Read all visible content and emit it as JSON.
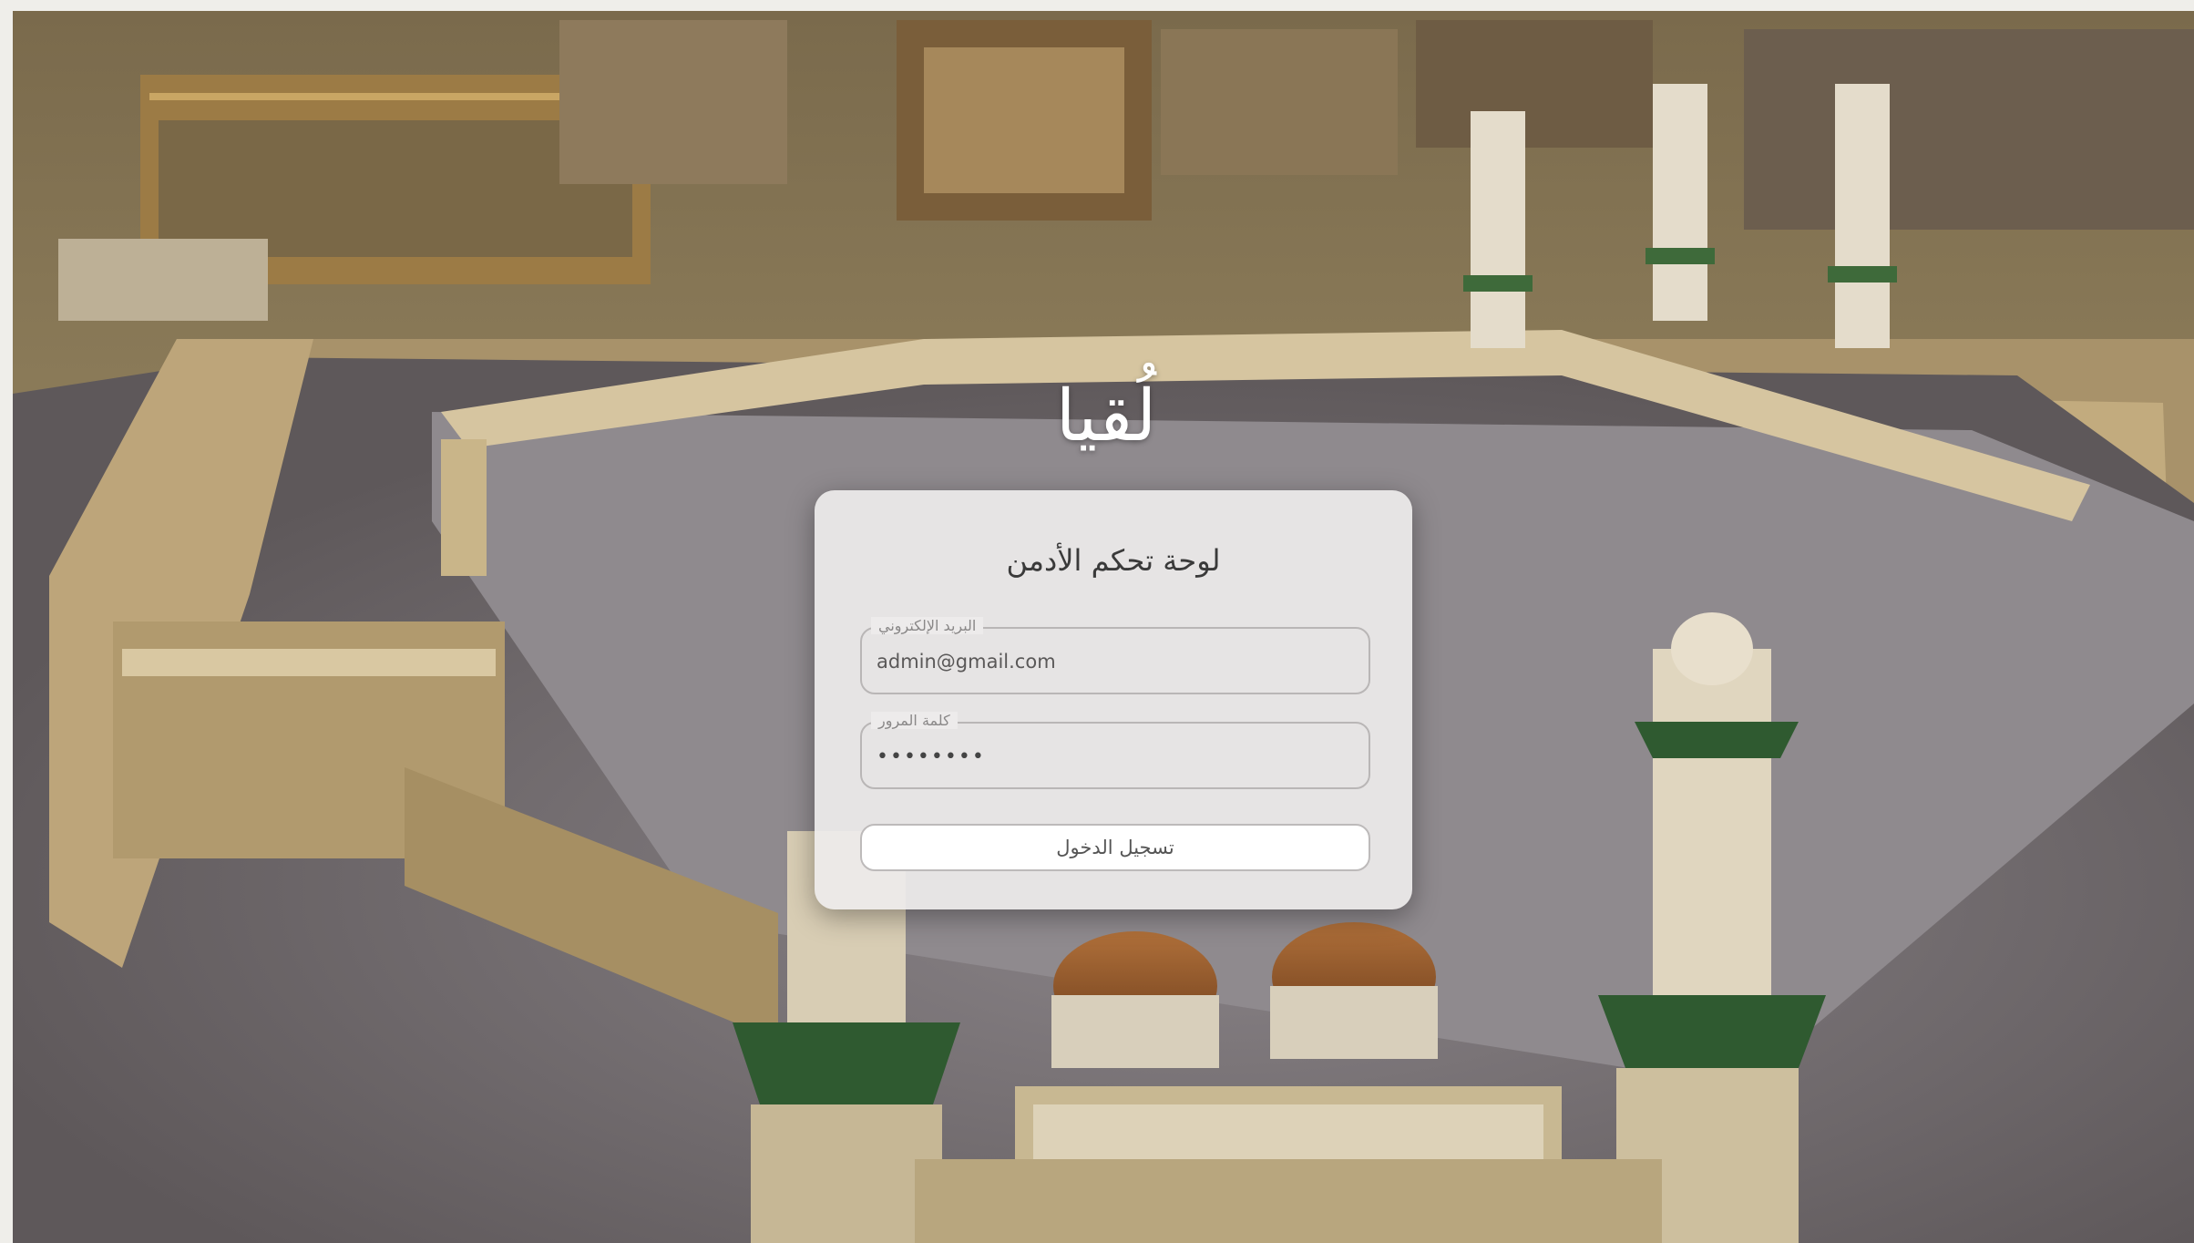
{
  "brand": {
    "name": "لُقيا"
  },
  "login": {
    "title": "لوحة تحكم الأدمن",
    "email_label": "البريد الإلكتروني",
    "email_value": "admin@gmail.com",
    "password_label": "كلمة المرور",
    "password_value": "password",
    "submit_label": "تسجيل الدخول"
  },
  "colors": {
    "card_background": "#eeecec",
    "brand_text": "#ffffff",
    "input_border": "#b9b6b6"
  }
}
